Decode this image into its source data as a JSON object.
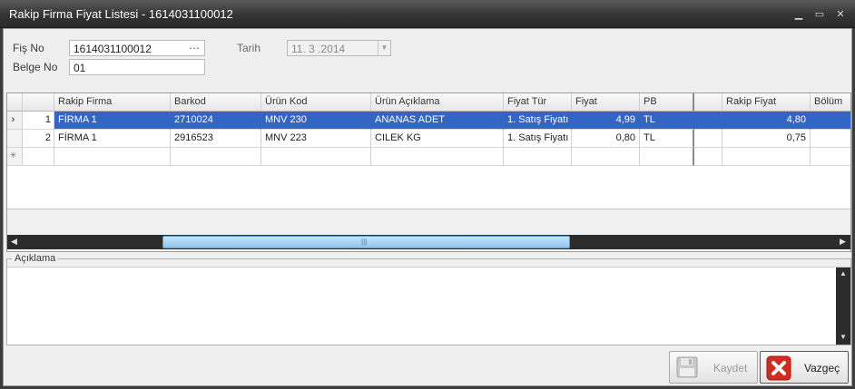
{
  "window": {
    "title": "Rakip Firma Fiyat Listesi - 1614031100012",
    "minimize": "▁",
    "maximize": "▭",
    "close": "✕"
  },
  "form": {
    "fis_no_label": "Fiş No",
    "fis_no_value": "1614031100012",
    "fis_no_ellipsis": "⋯",
    "belge_no_label": "Belge No",
    "belge_no_value": "01",
    "tarih_label": "Tarih",
    "tarih_value": "11. 3 .2014"
  },
  "grid": {
    "columns": [
      "Rakip Firma",
      "Barkod",
      "Ürün Kod",
      "Ürün Açıklama",
      "Fiyat Tür",
      "Fiyat",
      "PB",
      "",
      "Rakip Fiyat",
      "Bölüm"
    ],
    "rows": [
      {
        "no": "1",
        "rakip_firma": "FİRMA 1",
        "barkod": "2710024",
        "urun_kod": "MNV 230",
        "urun_aciklama": "ANANAS ADET",
        "fiyat_tur": "1. Satış Fiyatı",
        "fiyat": "4,99",
        "pb": "TL",
        "rakip_fiyat": "4,80",
        "bolum": "",
        "selected": true
      },
      {
        "no": "2",
        "rakip_firma": "FİRMA 1",
        "barkod": "2916523",
        "urun_kod": "MNV 223",
        "urun_aciklama": "CILEK  KG",
        "fiyat_tur": "1. Satış Fiyatı",
        "fiyat": "0,80",
        "pb": "TL",
        "rakip_fiyat": "0,75",
        "bolum": "",
        "selected": false
      }
    ],
    "current_row_marker": "›",
    "new_row_marker": "✳"
  },
  "aciklama": {
    "label": "Açıklama",
    "value": ""
  },
  "buttons": {
    "kaydet": "Kaydet",
    "vazgec": "Vazgeç"
  },
  "colors": {
    "selection": "#3465c4",
    "thumb": "#8fc6f0",
    "cancel_red": "#d42a1f"
  },
  "icons": {
    "kaydet": "floppy-disk-icon",
    "vazgec": "cancel-x-icon"
  }
}
